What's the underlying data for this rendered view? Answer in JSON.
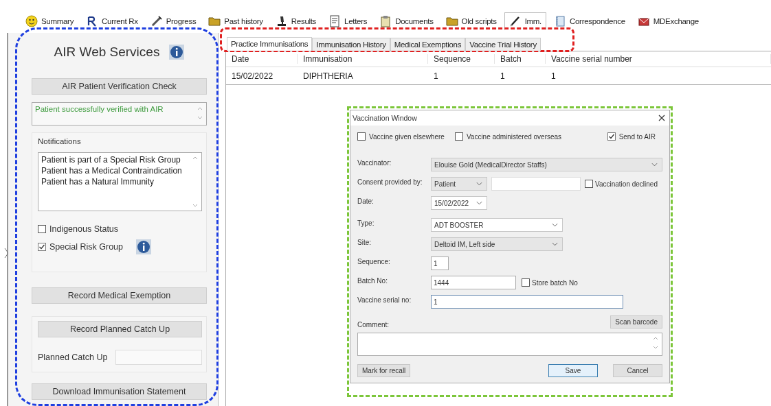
{
  "top_tabs": [
    {
      "label": "Summary",
      "kind": "smiley",
      "selected": false
    },
    {
      "label": "Current Rx",
      "kind": "rx",
      "selected": false
    },
    {
      "label": "Progress",
      "kind": "syringe",
      "selected": false
    },
    {
      "label": "Past history",
      "kind": "folder",
      "selected": false
    },
    {
      "label": "Results",
      "kind": "microscope",
      "selected": false
    },
    {
      "label": "Letters",
      "kind": "document",
      "selected": false
    },
    {
      "label": "Documents",
      "kind": "clipboard",
      "selected": false
    },
    {
      "label": "Old scripts",
      "kind": "folder",
      "selected": false
    },
    {
      "label": "Imm.",
      "kind": "pen",
      "selected": true
    },
    {
      "label": "Correspondence",
      "kind": "notebook",
      "selected": false
    },
    {
      "label": "MDExchange",
      "kind": "envelope",
      "selected": false
    }
  ],
  "air_panel": {
    "title": "AIR Web Services",
    "verify_button": "AIR Patient Verification Check",
    "verify_status": "Patient successfully verified with AIR",
    "notifications_label": "Notifications",
    "notifications": [
      "Patient is part of a Special Risk Group",
      "Patient has a Medical Contraindication",
      "Patient has a Natural Immunity"
    ],
    "checkboxes": [
      {
        "label": "Indigenous Status",
        "checked": false,
        "info": false
      },
      {
        "label": "Special Risk Group",
        "checked": true,
        "info": true
      }
    ],
    "exemption_button": "Record Medical Exemption",
    "catch_up_button": "Record Planned Catch Up",
    "catch_up_label": "Planned Catch Up",
    "download_button": "Download Immunisation Statement"
  },
  "sub_tabs": {
    "tabs": [
      {
        "label": "Practice Immunisations",
        "selected": true
      },
      {
        "label": "Immunisation History",
        "selected": false
      },
      {
        "label": "Medical Exemptions",
        "selected": false
      },
      {
        "label": "Vaccine Trial History",
        "selected": false
      }
    ]
  },
  "table": {
    "columns": [
      "Date",
      "Immunisation",
      "Sequence",
      "Batch",
      "Vaccine serial number"
    ],
    "rows": [
      [
        "15/02/2022",
        "DIPHTHERIA",
        "1",
        "1",
        "1"
      ]
    ]
  },
  "vaccination_window": {
    "title": "Vaccination Window",
    "options": [
      {
        "label": "Vaccine given elsewhere",
        "checked": false
      },
      {
        "label": "Vaccine administered overseas",
        "checked": false
      },
      {
        "label": "Send to AIR",
        "checked": true
      }
    ],
    "vaccinator_label": "Vaccinator:",
    "vaccinator": "Elouise Gold (MedicalDirector Staffs)",
    "consent_label": "Consent provided by:",
    "consent": "Patient",
    "declined": {
      "label": "Vaccination declined",
      "checked": false
    },
    "date_label": "Date:",
    "date": "15/02/2022",
    "type_label": "Type:",
    "type": "ADT BOOSTER",
    "site_label": "Site:",
    "site": "Deltoid IM, Left side",
    "sequence_label": "Sequence:",
    "sequence": "1",
    "batch_label": "Batch No:",
    "batch": "1444",
    "store_batch": {
      "label": "Store batch No",
      "checked": false
    },
    "serial_label": "Vaccine serial no:",
    "serial": "1",
    "scan_button": "Scan barcode",
    "comment_label": "Comment:",
    "recall_button": "Mark for recall",
    "save_button": "Save",
    "cancel_button": "Cancel"
  }
}
